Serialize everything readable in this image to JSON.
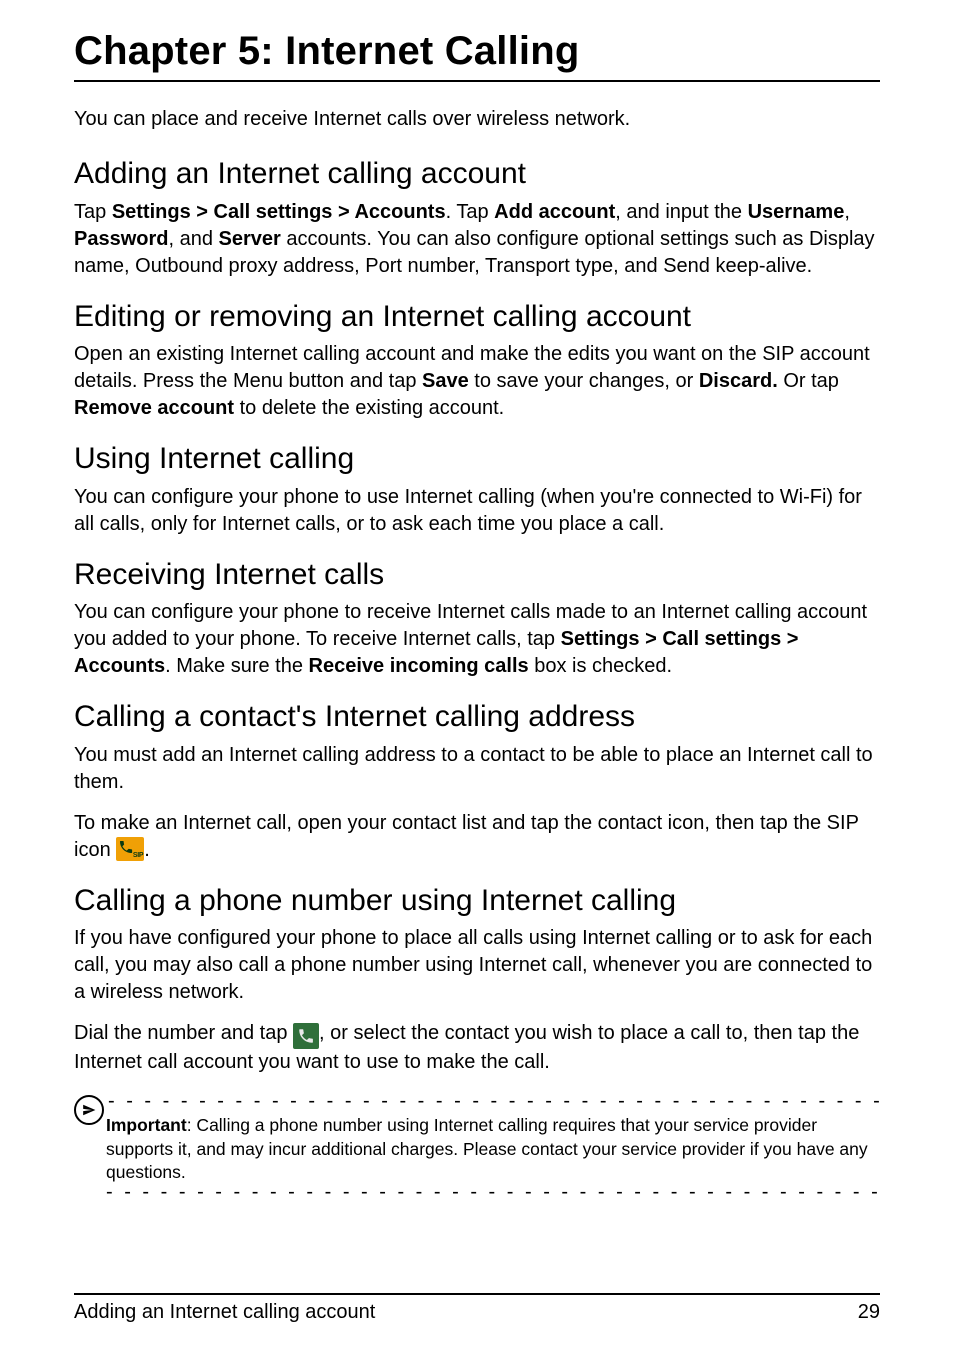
{
  "chapter_title": "Chapter 5: Internet Calling",
  "intro": "You can place and receive Internet calls over wireless network.",
  "sections": {
    "adding": {
      "heading": "Adding an Internet calling account",
      "p1_a": "Tap ",
      "p1_b": "Settings > Call settings > Accounts",
      "p1_c": ". Tap ",
      "p1_d": "Add account",
      "p1_e": ", and input the ",
      "p1_f": "Username",
      "p1_g": ", ",
      "p1_h": "Password",
      "p1_i": ", and ",
      "p1_j": "Server",
      "p1_k": " accounts. You can also configure optional settings such as Display name, Outbound proxy address, Port number, Transport type, and Send keep-alive."
    },
    "editing": {
      "heading": "Editing or removing an Internet calling account",
      "p1_a": "Open an existing Internet calling account and make the edits you want on the SIP account details. Press the Menu button and tap ",
      "p1_b": "Save",
      "p1_c": " to save your changes, or ",
      "p1_d": "Discard.",
      "p1_e": " Or tap ",
      "p1_f": "Remove account",
      "p1_g": " to delete the existing account."
    },
    "using": {
      "heading": "Using Internet calling",
      "p1": "You can configure your phone to use Internet calling (when you're connected to Wi-Fi) for all calls, only for Internet calls, or to ask each time you place a call."
    },
    "receiving": {
      "heading": "Receiving Internet calls",
      "p1_a": "You can configure your phone to receive Internet calls made to an Internet calling account you added to your phone. To receive Internet calls, tap ",
      "p1_b": "Settings > Call settings > Accounts",
      "p1_c": ". Make sure the ",
      "p1_d": "Receive incoming calls",
      "p1_e": " box is checked."
    },
    "calling_contact": {
      "heading": "Calling a contact's Internet calling address",
      "p1": "You must add an Internet calling address to a contact to be able to place an Internet call to them.",
      "p2_a": "To make an Internet call, open your contact list and tap the contact icon, then tap the SIP icon ",
      "p2_b": "."
    },
    "calling_number": {
      "heading": "Calling a phone number using Internet calling",
      "p1": "If you have configured your phone to place all calls using Internet calling or to ask for each call, you may also call a phone number using Internet call, whenever you are connected to a wireless network.",
      "p2_a": "Dial the number and tap ",
      "p2_b": ", or select the contact you wish to place a call to, then tap the Internet call account you want to use to make the call."
    }
  },
  "note": {
    "label": "Important",
    "text": ": Calling a phone number using Internet calling requires that your service provider supports it, and may incur additional charges. Please contact your service provider if you have any questions."
  },
  "footer": {
    "left": "Adding an Internet calling account",
    "right": "29"
  },
  "icons": {
    "sip_label": "SIP"
  }
}
